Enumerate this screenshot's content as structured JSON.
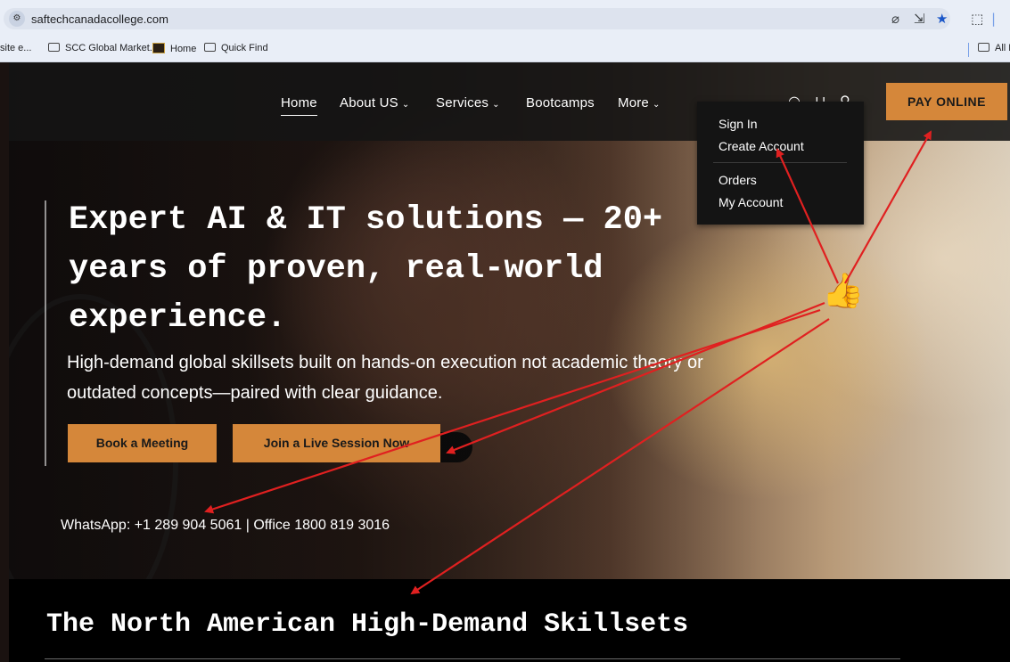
{
  "browser": {
    "url": "saftechcanadacollege.com",
    "site_info_icon": "site-settings-icon",
    "bookmarks": [
      "site e...",
      "SCC Global Market...",
      "Home",
      "Quick Find"
    ],
    "bookmarks_right": "All B"
  },
  "nav": {
    "items": [
      "Home",
      "About US",
      "Services",
      "Bootcamps",
      "More"
    ],
    "pay_label": "PAY ONLINE",
    "icons": [
      "search-icon",
      "cart-icon",
      "user-icon"
    ]
  },
  "account_menu": {
    "items": [
      "Sign In",
      "Create Account",
      "Orders",
      "My Account"
    ]
  },
  "hero": {
    "headline": "Expert AI & IT solutions — 20+ years of proven, real-world experience.",
    "subtext": "High-demand global skillsets built on hands-on execution not academic theory or outdated concepts—paired with clear guidance.",
    "book_label": "Book a Meeting",
    "join_label": "Join a Live Session Now",
    "contact": "WhatsApp: +1 289 904 5061 | Office 1800 819 3016"
  },
  "section": {
    "title": "The North American High-Demand Skillsets"
  },
  "annotation": {
    "emoji": "👍",
    "arrow_color": "#e02020"
  }
}
